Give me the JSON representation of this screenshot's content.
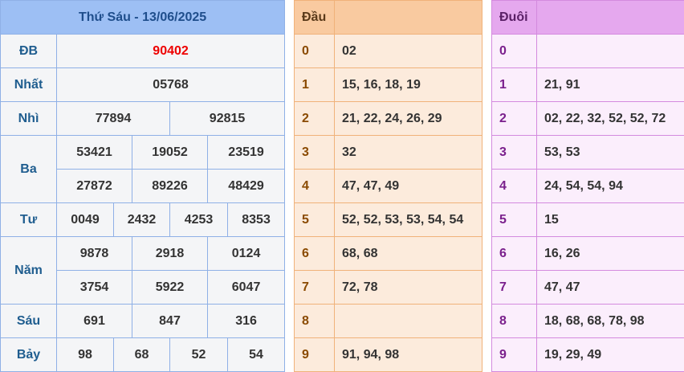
{
  "results": {
    "title": "Thứ Sáu - 13/06/2025",
    "rows": {
      "db": {
        "label": "ĐB",
        "values": [
          "90402"
        ]
      },
      "nhat": {
        "label": "Nhất",
        "values": [
          "05768"
        ]
      },
      "nhi": {
        "label": "Nhì",
        "values": [
          "77894",
          "92815"
        ]
      },
      "ba": {
        "label": "Ba",
        "values": [
          "53421",
          "19052",
          "23519",
          "27872",
          "89226",
          "48429"
        ]
      },
      "tu": {
        "label": "Tư",
        "values": [
          "0049",
          "2432",
          "4253",
          "8353"
        ]
      },
      "nam": {
        "label": "Năm",
        "values": [
          "9878",
          "2918",
          "0124",
          "3754",
          "5922",
          "6047"
        ]
      },
      "sau": {
        "label": "Sáu",
        "values": [
          "691",
          "847",
          "316"
        ]
      },
      "bay": {
        "label": "Bảy",
        "values": [
          "98",
          "68",
          "52",
          "54"
        ]
      }
    },
    "special_color": "#ee0000"
  },
  "dau": {
    "header": "Đầu",
    "rows": [
      {
        "k": "0",
        "v": "02"
      },
      {
        "k": "1",
        "v": "15, 16, 18, 19"
      },
      {
        "k": "2",
        "v": "21, 22, 24, 26, 29"
      },
      {
        "k": "3",
        "v": "32"
      },
      {
        "k": "4",
        "v": "47, 47, 49"
      },
      {
        "k": "5",
        "v": "52, 52, 53, 53, 54, 54"
      },
      {
        "k": "6",
        "v": "68, 68"
      },
      {
        "k": "7",
        "v": "72, 78"
      },
      {
        "k": "8",
        "v": ""
      },
      {
        "k": "9",
        "v": "91, 94, 98"
      }
    ]
  },
  "duoi": {
    "header": "Đuôi",
    "rows": [
      {
        "k": "0",
        "v": ""
      },
      {
        "k": "1",
        "v": "21, 91"
      },
      {
        "k": "2",
        "v": "02, 22, 32, 52, 52, 72"
      },
      {
        "k": "3",
        "v": "53, 53"
      },
      {
        "k": "4",
        "v": "24, 54, 54, 94"
      },
      {
        "k": "5",
        "v": "15"
      },
      {
        "k": "6",
        "v": "16, 26"
      },
      {
        "k": "7",
        "v": "47, 47"
      },
      {
        "k": "8",
        "v": "18, 68, 68, 78, 98"
      },
      {
        "k": "9",
        "v": "19, 29, 49"
      }
    ]
  }
}
